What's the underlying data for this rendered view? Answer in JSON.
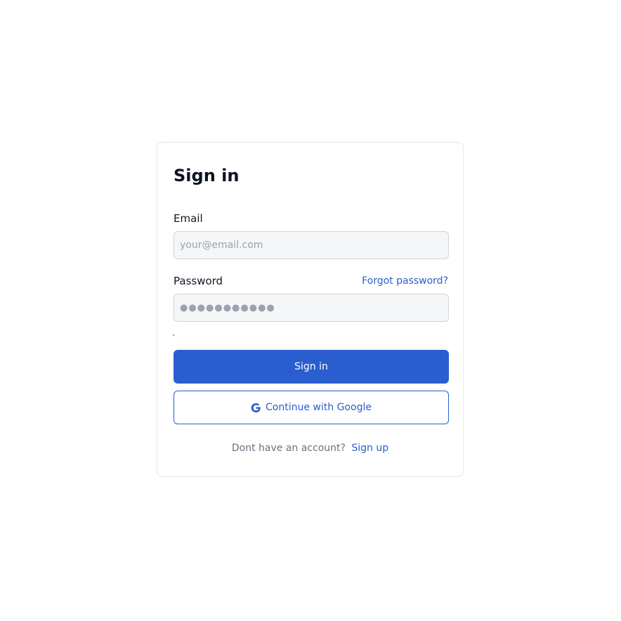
{
  "signin": {
    "title": "Sign in",
    "email_label": "Email",
    "email_placeholder": "your@email.com",
    "password_label": "Password",
    "forgot_password": "Forgot password?",
    "password_value": "●●●●●●●●●●●",
    "submit_label": "Sign in",
    "google_label": "Continue with Google",
    "footer_text": "Dont have an account?",
    "signup_label": "Sign up"
  },
  "icons": {
    "google": "google-g-icon"
  },
  "colors": {
    "primary": "#2a5ecf",
    "link": "#2f5fc4",
    "input_bg": "#f5f6f8",
    "card_border": "#e5e7eb"
  }
}
